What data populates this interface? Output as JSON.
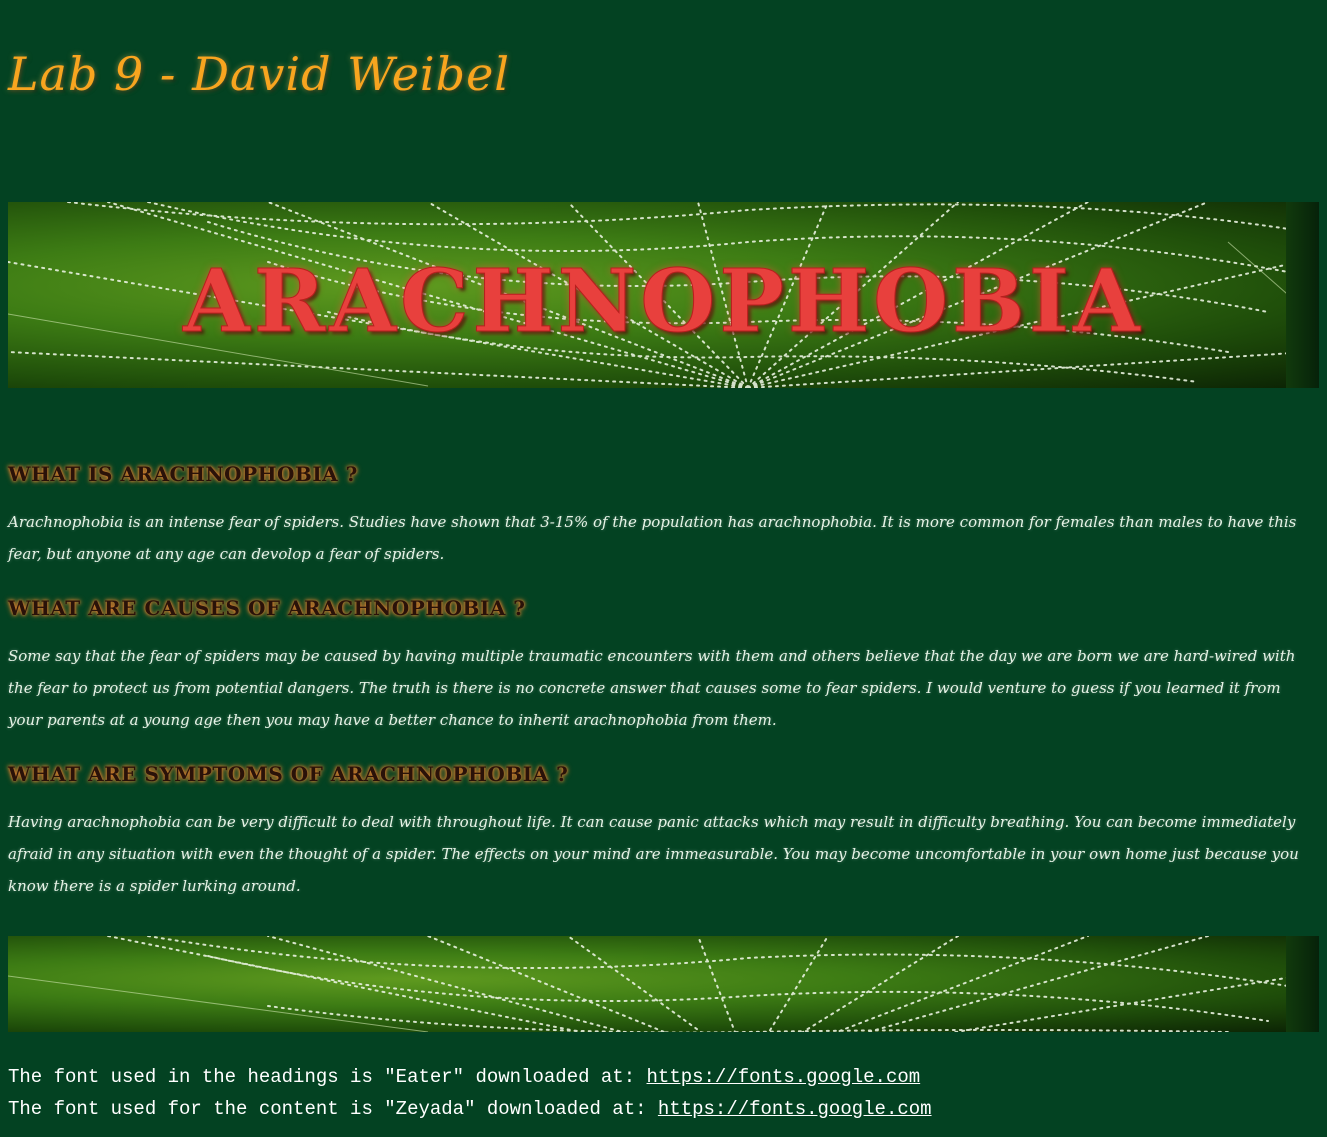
{
  "page": {
    "title": "Lab 9 - David Weibel"
  },
  "banner": {
    "text": "ARACHNOPHOBIA"
  },
  "sections": [
    {
      "heading": "WHAT IS ARACHNOPHOBIA ?",
      "text": "Arachnophobia is an intense fear of spiders. Studies have shown that 3-15% of the population has arachnophobia. It is more common for females than males to have this fear, but anyone at any age can devolop a fear of spiders."
    },
    {
      "heading": "WHAT ARE CAUSES OF ARACHNOPHOBIA ?",
      "text": "Some say that the fear of spiders may be caused by having multiple traumatic encounters with them and others believe that the day we are born we are hard-wired with the fear to protect us from potential dangers. The truth is there is no concrete answer that causes some to fear spiders. I would venture to guess if you learned it from your parents at a young age then you may have a better chance to inherit arachnophobia from them."
    },
    {
      "heading": "WHAT ARE SYMPTOMS OF ARACHNOPHOBIA ?",
      "text": "Having arachnophobia can be very difficult to deal with throughout life. It can cause panic attacks which may result in difficulty breathing. You can become immediately afraid in any situation with even the thought of a spider. The effects on your mind are immeasurable. You may become uncomfortable in your own home just because you know there is a spider lurking around."
    }
  ],
  "footer": {
    "line1_prefix": "The font used in the headings is \"Eater\" downloaded at: ",
    "line1_link": "https://fonts.google.com",
    "line2_prefix": "The font used for the content is \"Zeyada\" downloaded at: ",
    "line2_link": "https://fonts.google.com"
  },
  "colors": {
    "background": "#034222",
    "title": "#f8a51f",
    "banner_text": "#e8403d",
    "heading_glow": "#e8782a",
    "body_text": "#e6f3e6"
  }
}
